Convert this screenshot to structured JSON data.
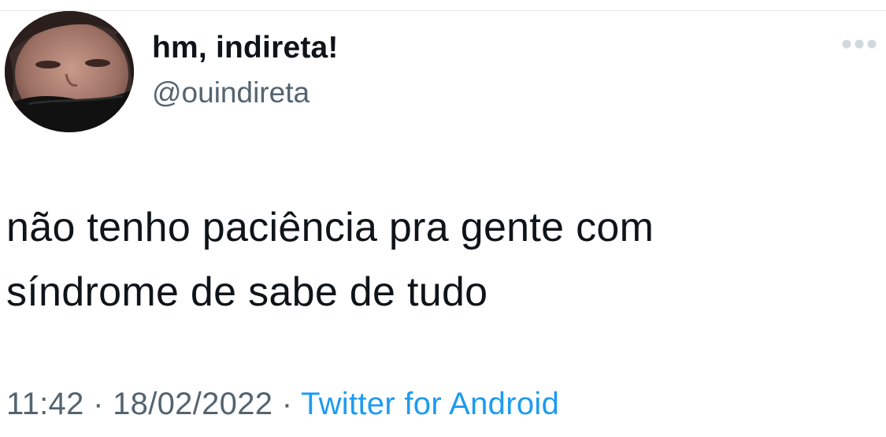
{
  "tweet": {
    "author": {
      "display_name": "hm, indireta!",
      "handle": "@ouindireta"
    },
    "text_lines": [
      "não tenho paciência pra gente com",
      "síndrome de sabe de tudo"
    ],
    "time": "11:42",
    "separator": "·",
    "date": "18/02/2022",
    "source": "Twitter for Android"
  },
  "icons": {
    "more": "more-horizontal-icon",
    "avatar": "profile-photo"
  },
  "colors": {
    "text_primary": "#0f1419",
    "text_secondary": "#536471",
    "link": "#1d9bf0",
    "more_dots": "#cfd9de"
  }
}
